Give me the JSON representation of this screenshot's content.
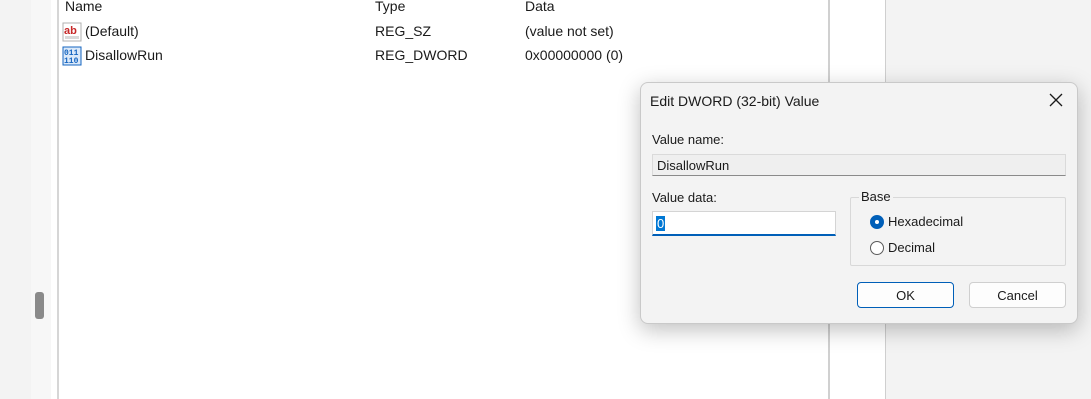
{
  "list": {
    "headers": {
      "name": "Name",
      "type": "Type",
      "data": "Data"
    },
    "rows": [
      {
        "name": "(Default)",
        "type": "REG_SZ",
        "data": "(value not set)",
        "icon": "string-value-icon"
      },
      {
        "name": "DisallowRun",
        "type": "REG_DWORD",
        "data": "0x00000000 (0)",
        "icon": "binary-value-icon"
      }
    ]
  },
  "dialog": {
    "title": "Edit DWORD (32-bit) Value",
    "value_name_label": "Value name:",
    "value_name": "DisallowRun",
    "value_data_label": "Value data:",
    "value_data": "0",
    "base_label": "Base",
    "base_options": [
      {
        "label": "Hexadecimal",
        "selected": true
      },
      {
        "label": "Decimal",
        "selected": false
      }
    ],
    "ok_label": "OK",
    "cancel_label": "Cancel"
  },
  "colors": {
    "accent": "#005fb8",
    "selection": "#0078d4",
    "string_icon": "#c62828",
    "binary_icon": "#1565c0"
  }
}
